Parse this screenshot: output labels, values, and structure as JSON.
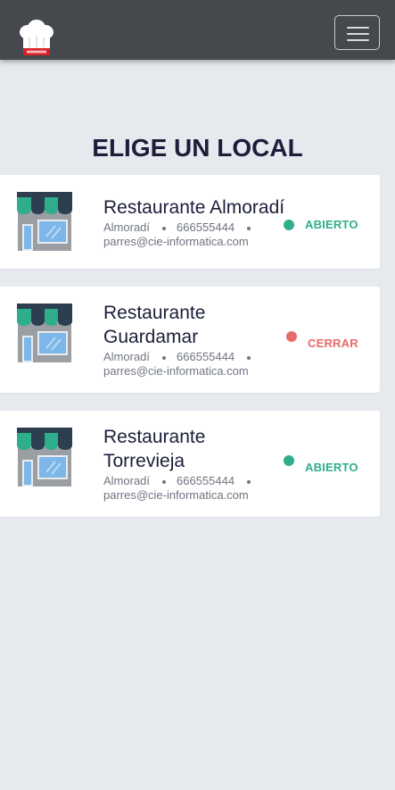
{
  "header": {
    "logo_icon": "chef-hat-icon",
    "menu_icon": "hamburger-menu-icon"
  },
  "page": {
    "title": "ELIGE UN LOCAL"
  },
  "colors": {
    "open": "#2fae8c",
    "closed": "#e86b6b",
    "navbar": "#45494d",
    "title": "#1b1e3a"
  },
  "locales": [
    {
      "name": "Restaurante Almoradí",
      "city": "Almoradí",
      "phone": "666555444",
      "email": "parres@cie-informatica.com",
      "status": "ABIERTO",
      "status_state": "open"
    },
    {
      "name": "Restaurante Guardamar",
      "city": "Almoradí",
      "phone": "666555444",
      "email": "parres@cie-informatica.com",
      "status": "CERRAR",
      "status_state": "closed"
    },
    {
      "name": "Restaurante Torrevieja",
      "city": "Almoradí",
      "phone": "666555444",
      "email": "parres@cie-informatica.com",
      "status": "ABIERTO",
      "status_state": "open"
    }
  ]
}
